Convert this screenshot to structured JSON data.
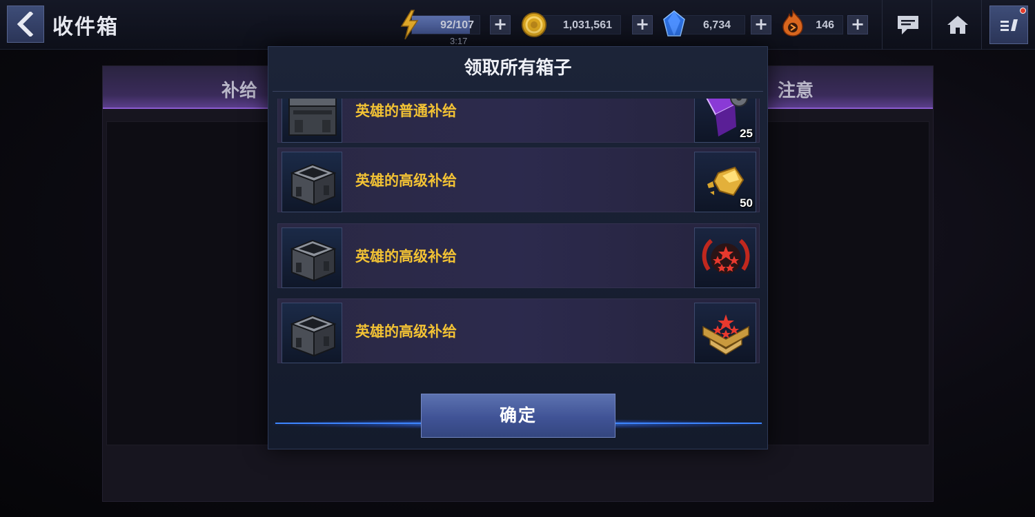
{
  "header": {
    "title": "收件箱",
    "energy": {
      "value": "92/107",
      "timer": "3:17",
      "fill_fraction": 0.86
    },
    "gold": "1,031,561",
    "crystals": "6,734",
    "fire": "146",
    "plus_label": "+"
  },
  "background": {
    "tab_supply": "补给",
    "tab_notice": "注意"
  },
  "modal": {
    "title": "领取所有箱子",
    "items": [
      {
        "label": "英雄的普通补给",
        "reward_icon": "purple-gear-cube-icon",
        "qty": "25"
      },
      {
        "label": "英雄的高级补给",
        "reward_icon": "gold-ore-icon",
        "qty": "50"
      },
      {
        "label": "英雄的高级补给",
        "reward_icon": "five-star-laurel-icon",
        "qty": ""
      },
      {
        "label": "英雄的高级补给",
        "reward_icon": "star-rank-chevron-icon",
        "qty": ""
      }
    ],
    "confirm_label": "确定"
  },
  "colors": {
    "item_label": "#f2c234",
    "accent_blue": "#3d86ff",
    "tab_purple": "#8b5cd0"
  }
}
